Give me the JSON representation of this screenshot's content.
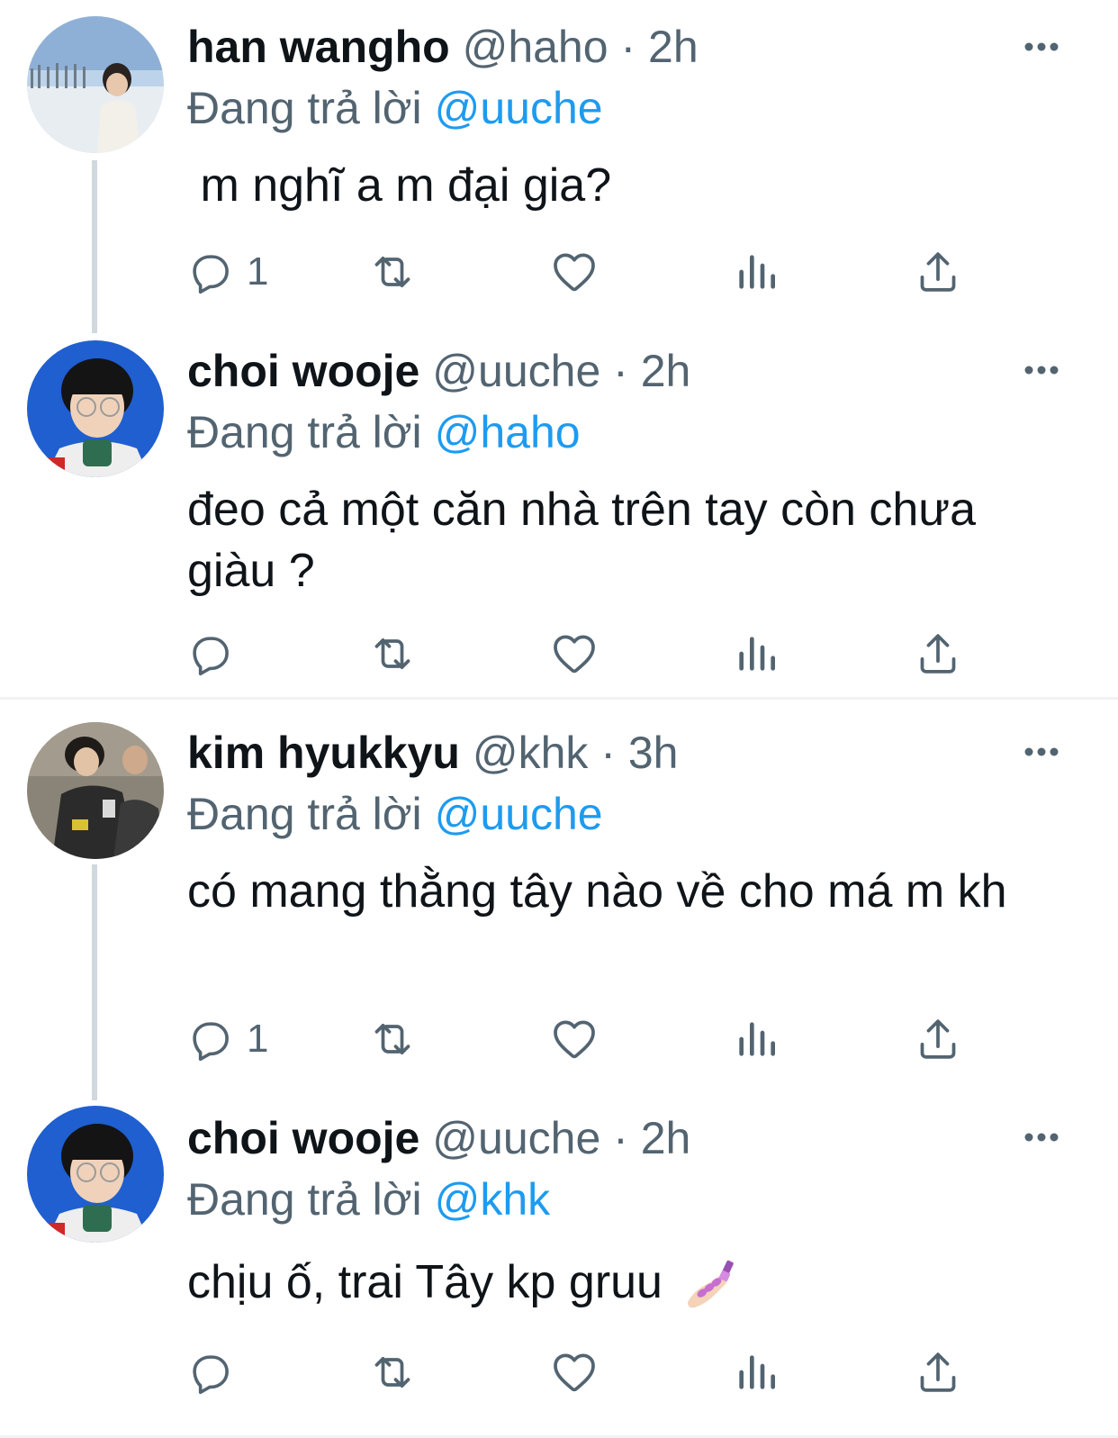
{
  "tweets": [
    {
      "name": "han wangho",
      "handle": "@haho",
      "time": "2h",
      "reply_prefix": "Đang trả lời",
      "reply_to": "@uuche",
      "text": " m nghĩ a m đại gia?",
      "reply_count": "1"
    },
    {
      "name": "choi wooje",
      "handle": "@uuche",
      "time": "2h",
      "reply_prefix": "Đang trả lời",
      "reply_to": "@haho",
      "text": "đeo cả một căn nhà trên tay còn chưa giàu ?",
      "reply_count": ""
    },
    {
      "name": "kim hyukkyu",
      "handle": "@khk",
      "time": "3h",
      "reply_prefix": "Đang trả lời",
      "reply_to": "@uuche",
      "text": "có mang thằng tây nào về cho má m kh",
      "reply_count": "1"
    },
    {
      "name": "choi wooje",
      "handle": "@uuche",
      "time": "2h",
      "reply_prefix": "Đang trả lời",
      "reply_to": "@khk",
      "text": "chịu ố, trai Tây kp gruu",
      "reply_count": ""
    }
  ],
  "separator": "·",
  "icons": [
    "reply-icon",
    "retweet-icon",
    "like-icon",
    "views-icon",
    "share-icon",
    "more-icon",
    "nail-polish-emoji"
  ],
  "colors": {
    "text": "#0f1419",
    "secondary": "#536471",
    "mention": "#1d9bf0",
    "line": "#cfd9de",
    "divider": "#eff3f4"
  }
}
